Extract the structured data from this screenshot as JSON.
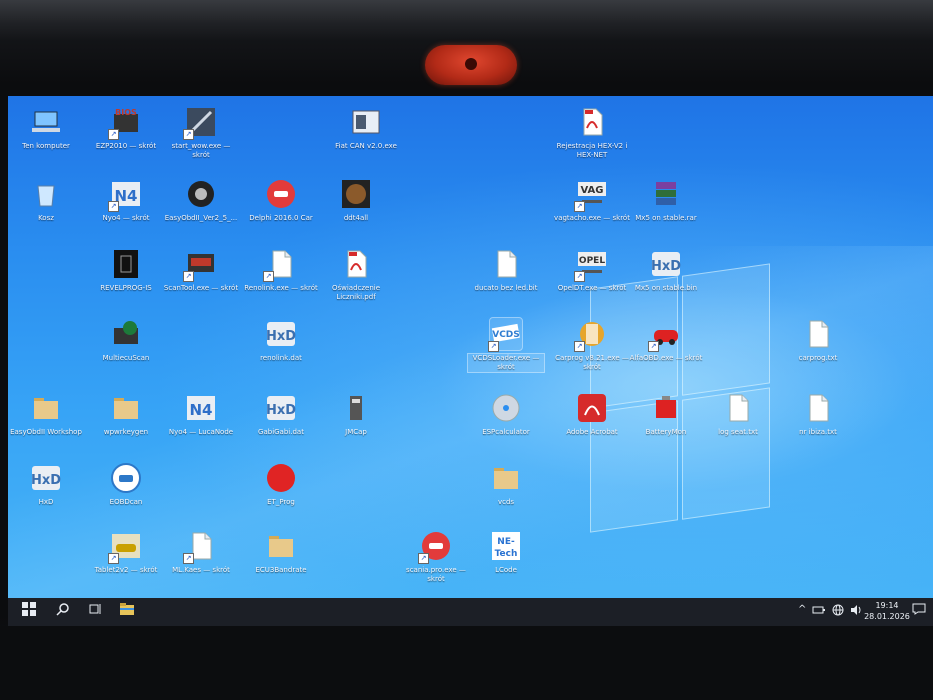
{
  "desktop": {
    "icons": [
      {
        "label": "Ten komputer",
        "icon": "computer-icon",
        "color": "#7fc4ff"
      },
      {
        "label": "EZP2010 — skrót",
        "icon": "bios-chip-icon",
        "color": "#c0392b"
      },
      {
        "label": "start_wow.exe — skrót",
        "icon": "tool-icon",
        "color": "#3b4a5e"
      },
      {
        "label": "Fiat CAN v2.0.exe",
        "icon": "window-app-icon",
        "color": "#e8eef6"
      },
      {
        "label": "Rejestracja HEX-V2 i HEX-NET",
        "icon": "pdf-icon",
        "color": "#d62b2b"
      },
      {
        "label": "Kosz",
        "icon": "recycle-bin-icon",
        "color": "#cfe8ff"
      },
      {
        "label": "Nyo4 — skrót",
        "icon": "n4-icon",
        "color": "#2f6fc9"
      },
      {
        "label": "EasyObdII_Ver2_5_...",
        "icon": "tire-icon",
        "color": "#222"
      },
      {
        "label": "Delphi 2016.0 Car",
        "icon": "car-red-icon",
        "color": "#e23b3b"
      },
      {
        "label": "ddt4all",
        "icon": "ddt4all-icon",
        "color": "#8b5a2b"
      },
      {
        "label": "vagtacho.exe — skrót",
        "icon": "vag-key-icon",
        "color": "#333"
      },
      {
        "label": "Mx5 on stable.rar",
        "icon": "winrar-icon",
        "color": "#7b3fa0"
      },
      {
        "label": "REVELPROG-IS",
        "icon": "revelprog-icon",
        "color": "#111"
      },
      {
        "label": "ScanTool.exe — skrót",
        "icon": "scantool-icon",
        "color": "#c0392b"
      },
      {
        "label": "Renolink.exe — skrót",
        "icon": "file-icon",
        "color": "#fff"
      },
      {
        "label": "Oświadczenie Liczniki.pdf",
        "icon": "pdf-icon",
        "color": "#d62b2b"
      },
      {
        "label": "ducato bez led.bit",
        "icon": "file-icon",
        "color": "#fff"
      },
      {
        "label": "OpelDT.exe — skrót",
        "icon": "opel-key-icon",
        "color": "#333"
      },
      {
        "label": "Mx5 on stable.bin",
        "icon": "hxd-icon",
        "color": "#3a6fb0"
      },
      {
        "label": "MultiecuScan",
        "icon": "multiecuscan-icon",
        "color": "#1d7a3a"
      },
      {
        "label": "renolink.dat",
        "icon": "hxd-icon",
        "color": "#3a6fb0"
      },
      {
        "label": "VCDSLoader.exe — skrót",
        "icon": "vcds-icon",
        "color": "#2f7dd1"
      },
      {
        "label": "Carprog v8.21.exe — skrót",
        "icon": "carprog-icon",
        "color": "#e6a52b"
      },
      {
        "label": "AlfaOBD.exe — skrót",
        "icon": "alfaobd-icon",
        "color": "#d22"
      },
      {
        "label": "carprog.txt",
        "icon": "file-icon",
        "color": "#fff"
      },
      {
        "label": "EasyObdII Workshop",
        "icon": "folder-icon",
        "color": "#e8c98a"
      },
      {
        "label": "wpwrkeygen",
        "icon": "folder-icon",
        "color": "#e8c98a"
      },
      {
        "label": "Nyo4 — LucaNode",
        "icon": "n4-icon",
        "color": "#2f6fc9"
      },
      {
        "label": "GabiGabi.dat",
        "icon": "hxd-icon",
        "color": "#3a6fb0"
      },
      {
        "label": "JMCap",
        "icon": "usb-icon",
        "color": "#555"
      },
      {
        "label": "ESPcalculator",
        "icon": "cd-icon",
        "color": "#cfd8e3"
      },
      {
        "label": "Adobe Acrobat",
        "icon": "acrobat-icon",
        "color": "#d62b2b"
      },
      {
        "label": "BatteryMon",
        "icon": "batterymon-icon",
        "color": "#d22"
      },
      {
        "label": "log seat.txt",
        "icon": "file-icon",
        "color": "#fff"
      },
      {
        "label": "nr ibiza.txt",
        "icon": "file-icon",
        "color": "#fff"
      },
      {
        "label": "HxD",
        "icon": "hxd-icon",
        "color": "#3a6fb0"
      },
      {
        "label": "EOBDcan",
        "icon": "eobd-icon",
        "color": "#2d78c8"
      },
      {
        "label": "ET_Prog",
        "icon": "red-circle-icon",
        "color": "#e02424"
      },
      {
        "label": "vcds",
        "icon": "folder-icon",
        "color": "#e8c98a"
      },
      {
        "label": "Tablet2v2 — skrót",
        "icon": "photo-car-icon",
        "color": "#c9a000"
      },
      {
        "label": "ML.Kaes — skrót",
        "icon": "file-icon",
        "color": "#fff"
      },
      {
        "label": "ECU3Bandrate",
        "icon": "folder-icon",
        "color": "#e8c98a"
      },
      {
        "label": "scania.pro.exe — skrót",
        "icon": "car-red-icon",
        "color": "#e23b3b"
      },
      {
        "label": "LCode",
        "icon": "netech-icon",
        "color": "#2a73d2"
      }
    ]
  },
  "taskbar": {
    "start_icon": "windows-start-icon",
    "search_icon": "search-icon",
    "taskview_icon": "task-view-icon",
    "explorer_icon": "file-explorer-icon",
    "time": "19:14",
    "date": "28.01.2026"
  }
}
